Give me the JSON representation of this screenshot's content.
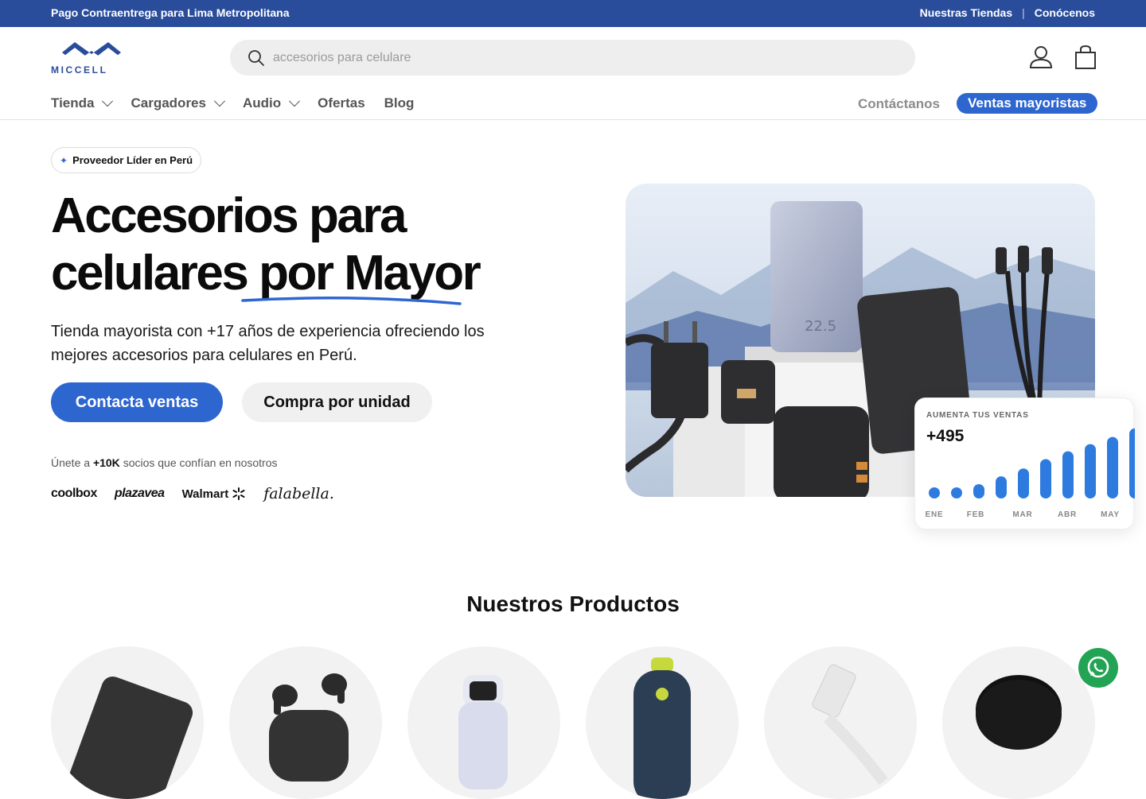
{
  "topbar": {
    "promo": "Pago Contraentrega para Lima Metropolitana",
    "links": [
      "Nuestras Tiendas",
      "Conócenos"
    ],
    "separator": "|",
    "bg_color": "#2a4d9b"
  },
  "header": {
    "logo_text": "MICCELL",
    "search": {
      "placeholder": "accesorios para celulare"
    },
    "icons": [
      "search-icon",
      "account-icon",
      "cart-icon"
    ]
  },
  "nav": {
    "items": [
      {
        "label": "Tienda",
        "has_dropdown": true
      },
      {
        "label": "Cargadores",
        "has_dropdown": true
      },
      {
        "label": "Audio",
        "has_dropdown": true
      },
      {
        "label": "Ofertas",
        "has_dropdown": false
      },
      {
        "label": "Blog",
        "has_dropdown": false
      }
    ],
    "contact": "Contáctanos",
    "wholesale": "Ventas mayoristas"
  },
  "hero": {
    "badge": "Proveedor Líder en Perú",
    "title_line1": "Accesorios para",
    "title_line2a": "celulares",
    "title_line2b": "por Mayor",
    "description": "Tienda mayorista con +17 años de experiencia ofreciendo los mejores accesorios para celulares en Perú.",
    "cta_primary": "Contacta ventas",
    "cta_secondary": "Compra por unidad",
    "join_prefix": "Únete a",
    "join_count": "+10K",
    "join_suffix": "socios que confían en nosotros",
    "brands": [
      "coolbox",
      "plazavea",
      "Walmart",
      "falabella."
    ],
    "accent_color": "#2e66d0"
  },
  "stats_card": {
    "label": "AUMENTA TUS VENTAS",
    "value": "+495",
    "chart_data": {
      "type": "bar",
      "x_labels": [
        "ENE",
        "FEB",
        "MAR",
        "ABR",
        "MAY"
      ],
      "bars": [
        0.1,
        0.14,
        0.2,
        0.31,
        0.42,
        0.55,
        0.66,
        0.76,
        0.86,
        0.98
      ]
    }
  },
  "products": {
    "title": "Nuestros Productos",
    "categories": [
      "power-bank",
      "earbuds",
      "smartwatch",
      "speaker",
      "usb-cable",
      "wireless-charger"
    ]
  },
  "whatsapp": {
    "icon": "whatsapp-icon",
    "color": "#23a455"
  }
}
